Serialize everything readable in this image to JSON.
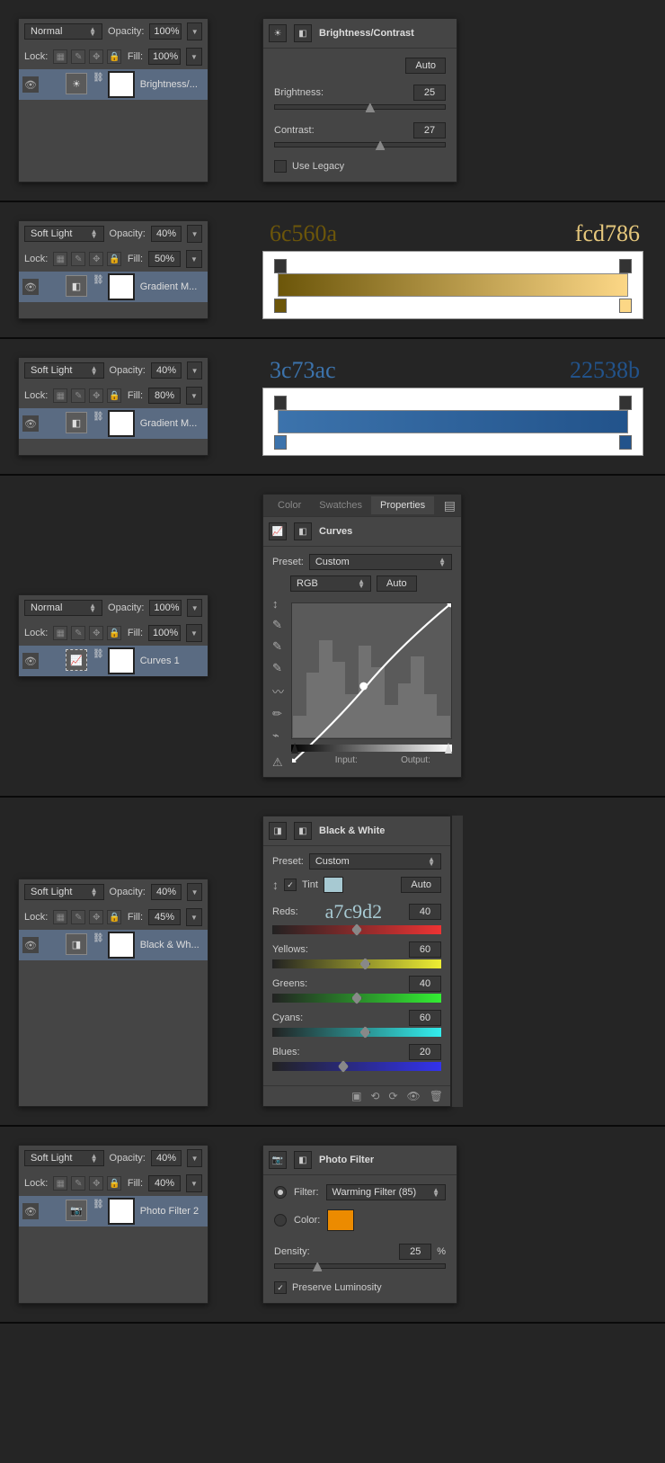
{
  "sec1": {
    "blend": "Normal",
    "op_label": "Opacity:",
    "op": "100%",
    "lock": "Lock:",
    "fill_label": "Fill:",
    "fill": "100%",
    "layer": "Brightness/...",
    "props_title": "Brightness/Contrast",
    "auto": "Auto",
    "b_label": "Brightness:",
    "b_val": "25",
    "c_label": "Contrast:",
    "c_val": "27",
    "legacy": "Use Legacy"
  },
  "sec2": {
    "blend": "Soft Light",
    "op": "40%",
    "fill": "50%",
    "layer": "Gradient M...",
    "hex1": "6c560a",
    "hex2": "fcd786"
  },
  "sec3": {
    "blend": "Soft Light",
    "op": "40%",
    "fill": "80%",
    "layer": "Gradient M...",
    "hex1": "3c73ac",
    "hex2": "22538b"
  },
  "sec4": {
    "blend": "Normal",
    "op": "100%",
    "fill": "100%",
    "layer": "Curves 1",
    "tabs": [
      "Color",
      "Swatches",
      "Properties"
    ],
    "title": "Curves",
    "preset_label": "Preset:",
    "preset": "Custom",
    "channel": "RGB",
    "auto": "Auto",
    "input": "Input:",
    "output": "Output:"
  },
  "sec5": {
    "blend": "Soft Light",
    "op": "40%",
    "fill": "45%",
    "layer": "Black & Wh...",
    "title": "Black & White",
    "preset_label": "Preset:",
    "preset": "Custom",
    "tint": "Tint",
    "tint_hex": "a7c9d2",
    "tint_color": "#a7c9d2",
    "auto": "Auto",
    "rows": [
      {
        "name": "Reds:",
        "val": "40",
        "cls": "bw-grad-red",
        "pos": 50
      },
      {
        "name": "Yellows:",
        "val": "60",
        "cls": "bw-grad-yellow",
        "pos": 55
      },
      {
        "name": "Greens:",
        "val": "40",
        "cls": "bw-grad-green",
        "pos": 50
      },
      {
        "name": "Cyans:",
        "val": "60",
        "cls": "bw-grad-cyan",
        "pos": 55
      },
      {
        "name": "Blues:",
        "val": "20",
        "cls": "bw-grad-blue",
        "pos": 42
      }
    ]
  },
  "sec6": {
    "blend": "Soft Light",
    "op": "40%",
    "fill": "40%",
    "layer": "Photo Filter 2",
    "title": "Photo Filter",
    "filter_label": "Filter:",
    "filter": "Warming Filter (85)",
    "color_label": "Color:",
    "color": "#ec8b00",
    "density_label": "Density:",
    "density": "25",
    "pct": "%",
    "preserve": "Preserve Luminosity"
  },
  "common": {
    "op_label": "Opacity:",
    "lock": "Lock:",
    "fill_label": "Fill:"
  }
}
